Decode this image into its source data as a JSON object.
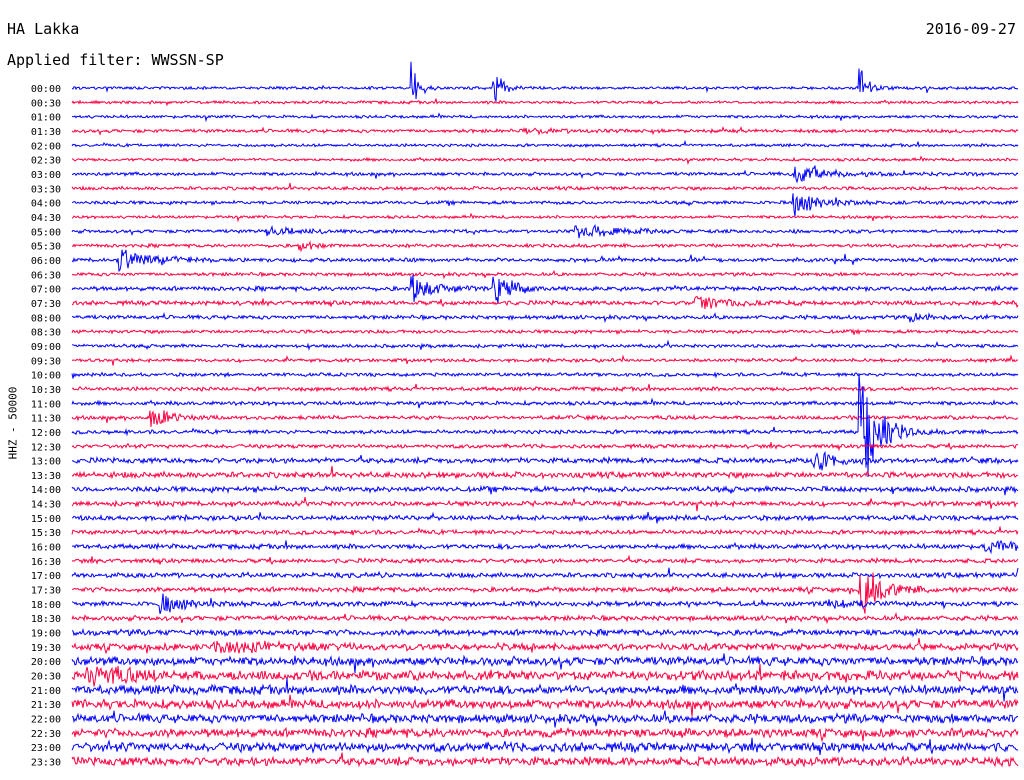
{
  "header": {
    "station": "HA Lakka",
    "date": "2016-09-27",
    "filter": "Applied filter: WWSSN-SP"
  },
  "chart_data": {
    "type": "line",
    "title": "HA Lakka",
    "ylabel": "HHZ - 50000",
    "row_labels": [
      "00:00",
      "00:30",
      "01:00",
      "01:30",
      "02:00",
      "02:30",
      "03:00",
      "03:30",
      "04:00",
      "04:30",
      "05:00",
      "05:30",
      "06:00",
      "06:30",
      "07:00",
      "07:30",
      "08:00",
      "08:30",
      "09:00",
      "09:30",
      "10:00",
      "10:30",
      "11:00",
      "11:30",
      "12:00",
      "12:30",
      "13:00",
      "13:30",
      "14:00",
      "14:30",
      "15:00",
      "15:30",
      "16:00",
      "16:30",
      "17:00",
      "17:30",
      "18:00",
      "18:30",
      "19:00",
      "19:30",
      "20:00",
      "20:30",
      "21:00",
      "21:30",
      "22:00",
      "22:30",
      "23:00",
      "23:30"
    ],
    "trace_colors": [
      "#0000ff",
      "#ff0040"
    ],
    "x_minutes_per_row": 30,
    "noise_by_row": [
      0.6,
      0.6,
      0.6,
      0.7,
      0.6,
      0.6,
      0.7,
      0.7,
      0.7,
      0.6,
      0.7,
      0.7,
      0.8,
      0.7,
      0.9,
      0.9,
      0.8,
      0.7,
      0.7,
      0.7,
      0.7,
      0.8,
      0.8,
      0.8,
      0.8,
      0.8,
      1.1,
      1.2,
      1.1,
      1.0,
      1.0,
      0.9,
      1.0,
      0.9,
      1.0,
      1.0,
      1.0,
      1.0,
      1.2,
      1.4,
      1.8,
      2.0,
      1.9,
      1.9,
      1.8,
      1.8,
      1.9,
      1.8
    ],
    "events": [
      {
        "row": 0,
        "minute": 10.8,
        "peak": 26,
        "decay_min": 0.2
      },
      {
        "row": 0,
        "minute": 13.4,
        "peak": 26,
        "decay_min": 0.2
      },
      {
        "row": 0,
        "minute": 25.0,
        "peak": 26,
        "decay_min": 0.2
      },
      {
        "row": 14,
        "minute": 10.8,
        "peak": 14,
        "decay_min": 0.6
      },
      {
        "row": 14,
        "minute": 13.4,
        "peak": 14,
        "decay_min": 0.6
      },
      {
        "row": 12,
        "minute": 1.5,
        "peak": 12,
        "decay_min": 0.9
      },
      {
        "row": 6,
        "minute": 22.9,
        "peak": 14,
        "decay_min": 0.8
      },
      {
        "row": 8,
        "minute": 22.9,
        "peak": 12,
        "decay_min": 0.8
      },
      {
        "row": 10,
        "minute": 16.0,
        "peak": 7,
        "decay_min": 1.2
      },
      {
        "row": 10,
        "minute": 6.2,
        "peak": 5,
        "decay_min": 0.8
      },
      {
        "row": 11,
        "minute": 7.2,
        "peak": 9,
        "decay_min": 0.3
      },
      {
        "row": 3,
        "minute": 14.3,
        "peak": 3,
        "decay_min": 1.0
      },
      {
        "row": 15,
        "minute": 19.8,
        "peak": 7,
        "decay_min": 1.0
      },
      {
        "row": 15,
        "minute": 30.0,
        "peak": 6,
        "decay_min": 1.5
      },
      {
        "row": 16,
        "minute": 26.6,
        "peak": 4,
        "decay_min": 0.6
      },
      {
        "row": 23,
        "minute": 2.5,
        "peak": 14,
        "decay_min": 0.5
      },
      {
        "row": 26,
        "minute": 23.5,
        "peak": 10,
        "decay_min": 0.7
      },
      {
        "row": 24,
        "minute": 25.0,
        "peak": 70,
        "decay_min": 0.5
      },
      {
        "row": 35,
        "minute": 25.0,
        "peak": 28,
        "decay_min": 0.6
      },
      {
        "row": 36,
        "minute": 2.8,
        "peak": 9,
        "decay_min": 0.8
      },
      {
        "row": 36,
        "minute": 24.0,
        "peak": 4,
        "decay_min": 1.0
      },
      {
        "row": 34,
        "minute": 30.0,
        "peak": 28,
        "decay_min": 2.5
      },
      {
        "row": 41,
        "minute": 0.5,
        "peak": 12,
        "decay_min": 1.0
      },
      {
        "row": 32,
        "minute": 29.0,
        "peak": 5,
        "decay_min": 1.0
      },
      {
        "row": 39,
        "minute": 4.5,
        "peak": 6,
        "decay_min": 2.0
      }
    ]
  }
}
